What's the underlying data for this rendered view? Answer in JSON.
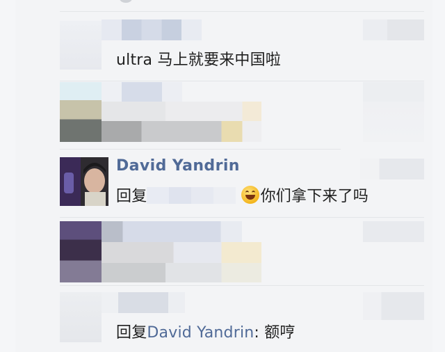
{
  "comments": [
    {
      "text": "ultra 马上就要来中国啦"
    },
    {},
    {
      "author": "David Yandrin",
      "reply_prefix": "回复",
      "emoji": "grinning-face-icon",
      "text": "你们拿下来了吗"
    },
    {},
    {
      "reply_prefix": "回复",
      "reply_to": "David Yandrin",
      "text": ": 额哼"
    }
  ],
  "colors": {
    "background": "#f3f4f6",
    "author_name": "#506a97",
    "text": "#1f1f1f",
    "separator": "#e3e5e8"
  }
}
